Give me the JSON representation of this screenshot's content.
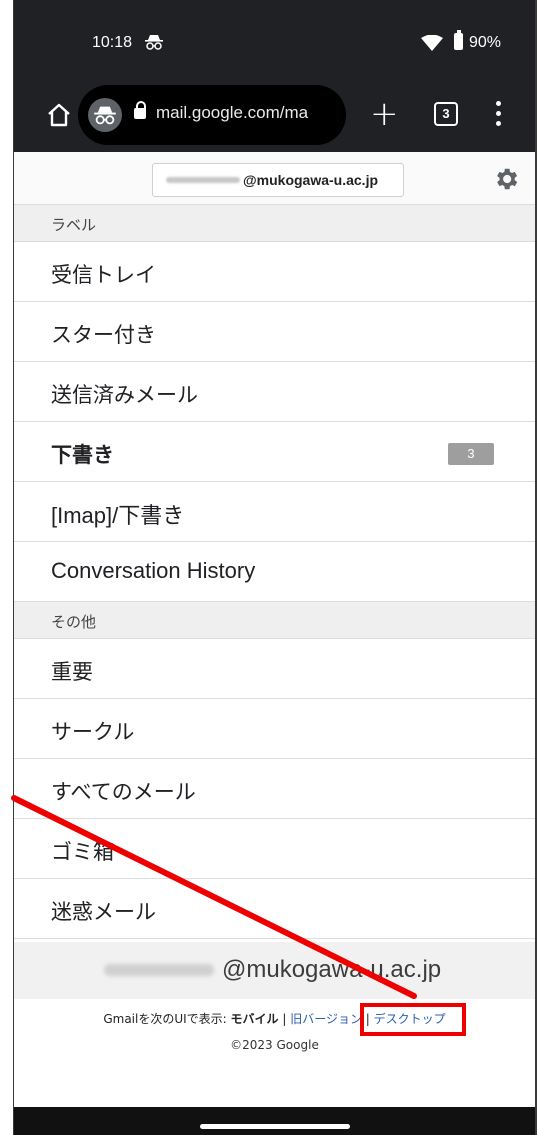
{
  "status_bar": {
    "time": "10:18",
    "battery": "90%",
    "icons": [
      "incognito-icon",
      "wifi-icon",
      "battery-icon"
    ]
  },
  "browser": {
    "url": "mail.google.com/ma",
    "tab_count": "3",
    "new_tab_label": "+",
    "icons": [
      "home-icon",
      "incognito-icon",
      "lock-icon",
      "tab-switcher-icon",
      "more-menu-icon"
    ]
  },
  "account": {
    "email_suffix": "@mukogawa-u.ac.jp",
    "settings_icon": "gear-icon"
  },
  "sections": {
    "labels_header": "ラベル",
    "other_header": "その他"
  },
  "labels": [
    {
      "label": "受信トレイ"
    },
    {
      "label": "スター付き"
    },
    {
      "label": "送信済みメール"
    },
    {
      "label": "下書き",
      "count": "3"
    },
    {
      "label": "[Imap]/下書き"
    },
    {
      "label": "Conversation History"
    }
  ],
  "other": [
    {
      "label": "重要"
    },
    {
      "label": "サークル"
    },
    {
      "label": "すべてのメール"
    },
    {
      "label": "ゴミ箱"
    },
    {
      "label": "迷惑メール"
    }
  ],
  "footer": {
    "email_suffix": "@mukogawa-u.ac.jp",
    "view_prefix": "Gmailを次のUIで表示: ",
    "mobile": "モバイル",
    "separator": " | ",
    "old_version": "旧バージョン",
    "desktop": "デスクトップ",
    "copyright": "©2023 Google"
  },
  "colors": {
    "browser_chrome": "#202124",
    "badge": "#9e9e9e",
    "link": "#2a5db0",
    "annotation": "#ee0000"
  }
}
